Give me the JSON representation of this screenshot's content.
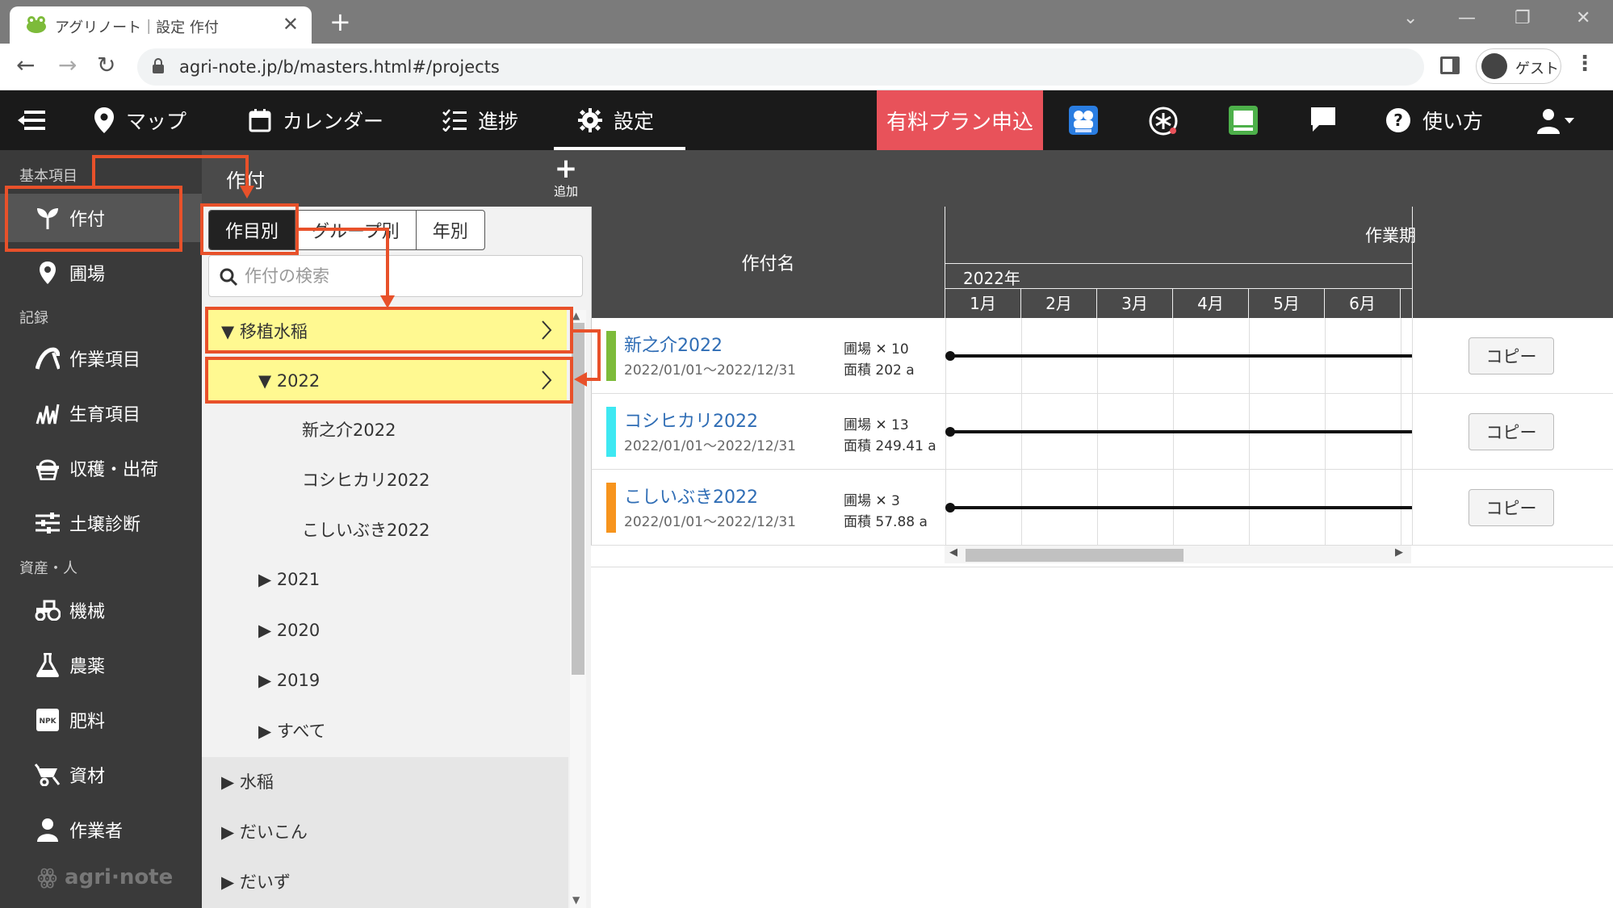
{
  "browser": {
    "tab_title": "アグリノート｜設定 作付",
    "url": "agri-note.jp/b/masters.html#/projects",
    "profile_label": "ゲスト"
  },
  "header": {
    "nav": [
      {
        "label": "マップ"
      },
      {
        "label": "カレンダー"
      },
      {
        "label": "進捗"
      },
      {
        "label": "設定"
      }
    ],
    "promo_label": "有料プラン申込",
    "help_label": "使い方",
    "active_index": 3
  },
  "sidebar": {
    "sections": [
      "基本項目",
      "記録",
      "資産・人"
    ],
    "items": [
      {
        "label": "作付"
      },
      {
        "label": "圃場"
      },
      {
        "label": "作業項目"
      },
      {
        "label": "生育項目"
      },
      {
        "label": "収穫・出荷"
      },
      {
        "label": "土壌診断"
      },
      {
        "label": "機械"
      },
      {
        "label": "農薬"
      },
      {
        "label": "肥料"
      },
      {
        "label": "資材"
      },
      {
        "label": "作業者"
      }
    ],
    "logo": "agri·note",
    "npk_text": "NPK"
  },
  "subbar": {
    "title": "作付",
    "add_label": "追加"
  },
  "tree": {
    "segments": [
      "作目別",
      "グループ別",
      "年別"
    ],
    "search_placeholder": "作付の検索",
    "rows": [
      {
        "label": "▼ 移植水稲"
      },
      {
        "label": "▼ 2022"
      },
      {
        "label": "新之介2022"
      },
      {
        "label": "コシヒカリ2022"
      },
      {
        "label": "こしいぶき2022"
      },
      {
        "label": "▶ 2021"
      },
      {
        "label": "▶ 2020"
      },
      {
        "label": "▶ 2019"
      },
      {
        "label": "▶ すべて"
      },
      {
        "label": "▶ 水稲"
      },
      {
        "label": "▶ だいこん"
      },
      {
        "label": "▶ だいず"
      }
    ]
  },
  "gantt": {
    "col_name": "作付名",
    "col_period": "作業期",
    "year": "2022年",
    "months": [
      "1月",
      "2月",
      "3月",
      "4月",
      "5月",
      "6月"
    ],
    "copy_label": "コピー",
    "rows": [
      {
        "name": "新之介2022",
        "dates": "2022/01/01～2022/12/31",
        "fields": "圃場 ✕ 10",
        "area": "面積 202 a",
        "color": "#7dbb3a"
      },
      {
        "name": "コシヒカリ2022",
        "dates": "2022/01/01～2022/12/31",
        "fields": "圃場 ✕ 13",
        "area": "面積 249.41 a",
        "color": "#3ee8f2"
      },
      {
        "name": "こしいぶき2022",
        "dates": "2022/01/01～2022/12/31",
        "fields": "圃場 ✕ 3",
        "area": "面積 57.88 a",
        "color": "#f7941d"
      }
    ]
  },
  "colors": {
    "header_bg": "#1a1a1a",
    "sidebar_bg": "#3a3a3a",
    "promo": "#e8525a",
    "highlight": "#fff991",
    "annotation": "#e8512a",
    "link": "#2f6db5"
  }
}
